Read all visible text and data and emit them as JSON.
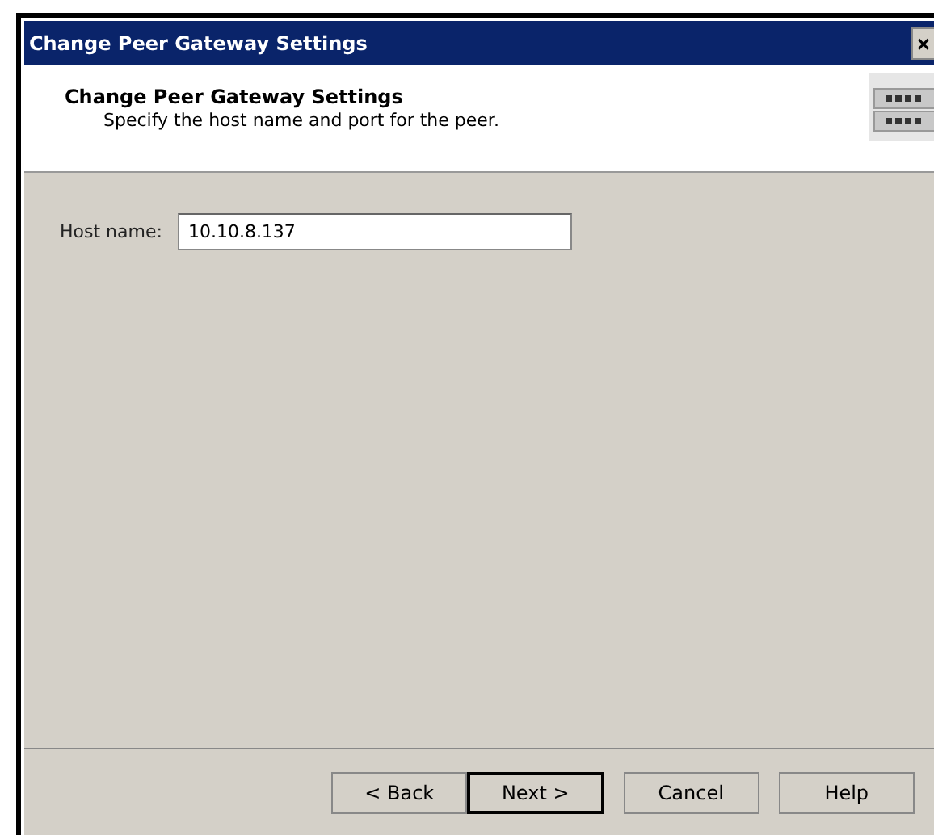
{
  "window": {
    "title": "Change Peer Gateway Settings",
    "close": "×"
  },
  "header": {
    "title": "Change Peer Gateway Settings",
    "subtitle": "Specify the host name and port for the peer."
  },
  "form": {
    "label": "Host name:",
    "value": "10.10.8.137"
  },
  "buttons": [
    {
      "label": "< Back",
      "default": false
    },
    {
      "label": "Next >",
      "default": true
    },
    {
      "label": "Cancel",
      "default": false
    },
    {
      "label": "Help",
      "default": false
    }
  ]
}
